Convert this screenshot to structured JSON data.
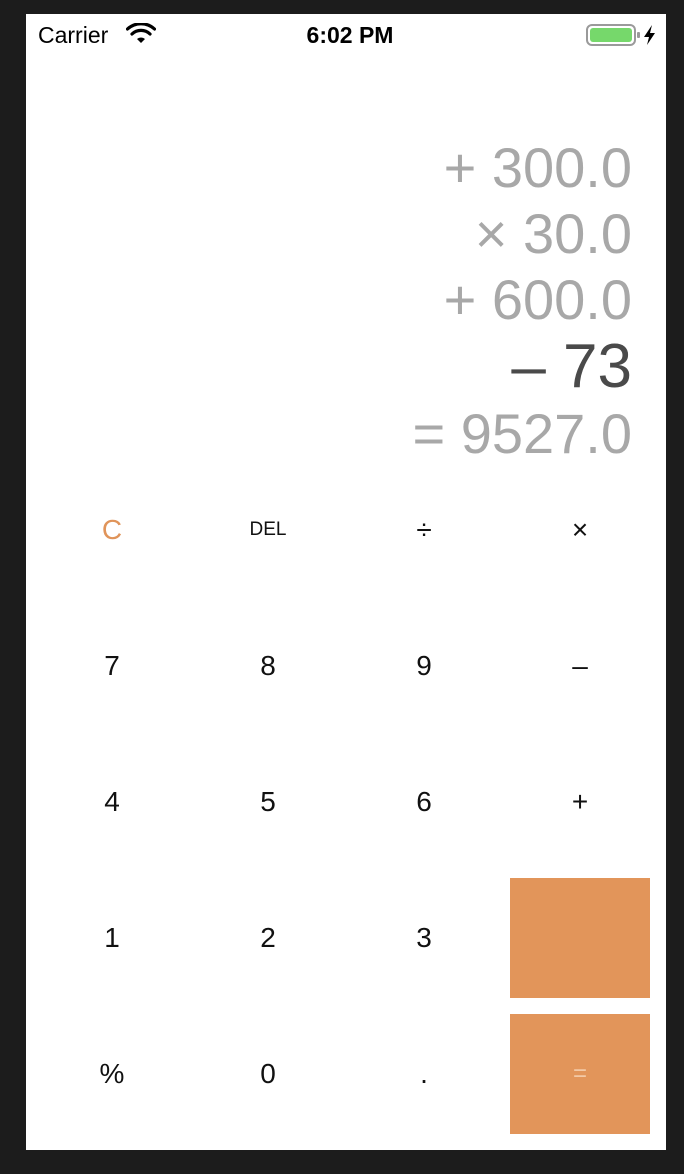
{
  "status_bar": {
    "carrier": "Carrier",
    "time": "6:02 PM",
    "wifi_icon": "wifi-icon",
    "battery_icon": "battery-charging-icon",
    "battery_color": "#76d86b"
  },
  "display": {
    "lines": [
      "+ 300.0",
      "× 30.0",
      "+ 600.0",
      "– 73",
      "= 9527.0"
    ],
    "current_line_index": 3
  },
  "keypad": {
    "row1": [
      "C",
      "DEL",
      "÷",
      "×"
    ],
    "row2": [
      "7",
      "8",
      "9",
      "–"
    ],
    "row3": [
      "4",
      "5",
      "6",
      "+"
    ],
    "row4": [
      "1",
      "2",
      "3"
    ],
    "row5": [
      "%",
      "0",
      "."
    ],
    "equals": "=",
    "accent_color": "#e2955a"
  }
}
